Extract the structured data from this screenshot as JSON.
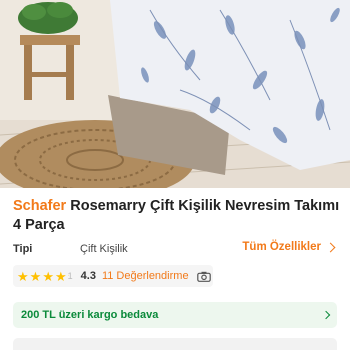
{
  "product": {
    "brand": "Schafer",
    "name": "Rosemarry Çift Kişilik Nevresim Takımı 4 Parça"
  },
  "properties": {
    "key": "Tipi",
    "value": "Çift Kişilik",
    "all_label": "Tüm Özellikler"
  },
  "rating": {
    "score": "4.3",
    "value": 4.3,
    "partial_star_label": "1",
    "reviews": "11 Değerlendirme",
    "icon": "camera-icon"
  },
  "shipping": {
    "text": "200 TL üzeri kargo bedava",
    "icon": "chevron-right-icon"
  },
  "colors": {
    "accent": "#f27a1a",
    "success": "#0a8a3a",
    "star": "#ffc000"
  }
}
